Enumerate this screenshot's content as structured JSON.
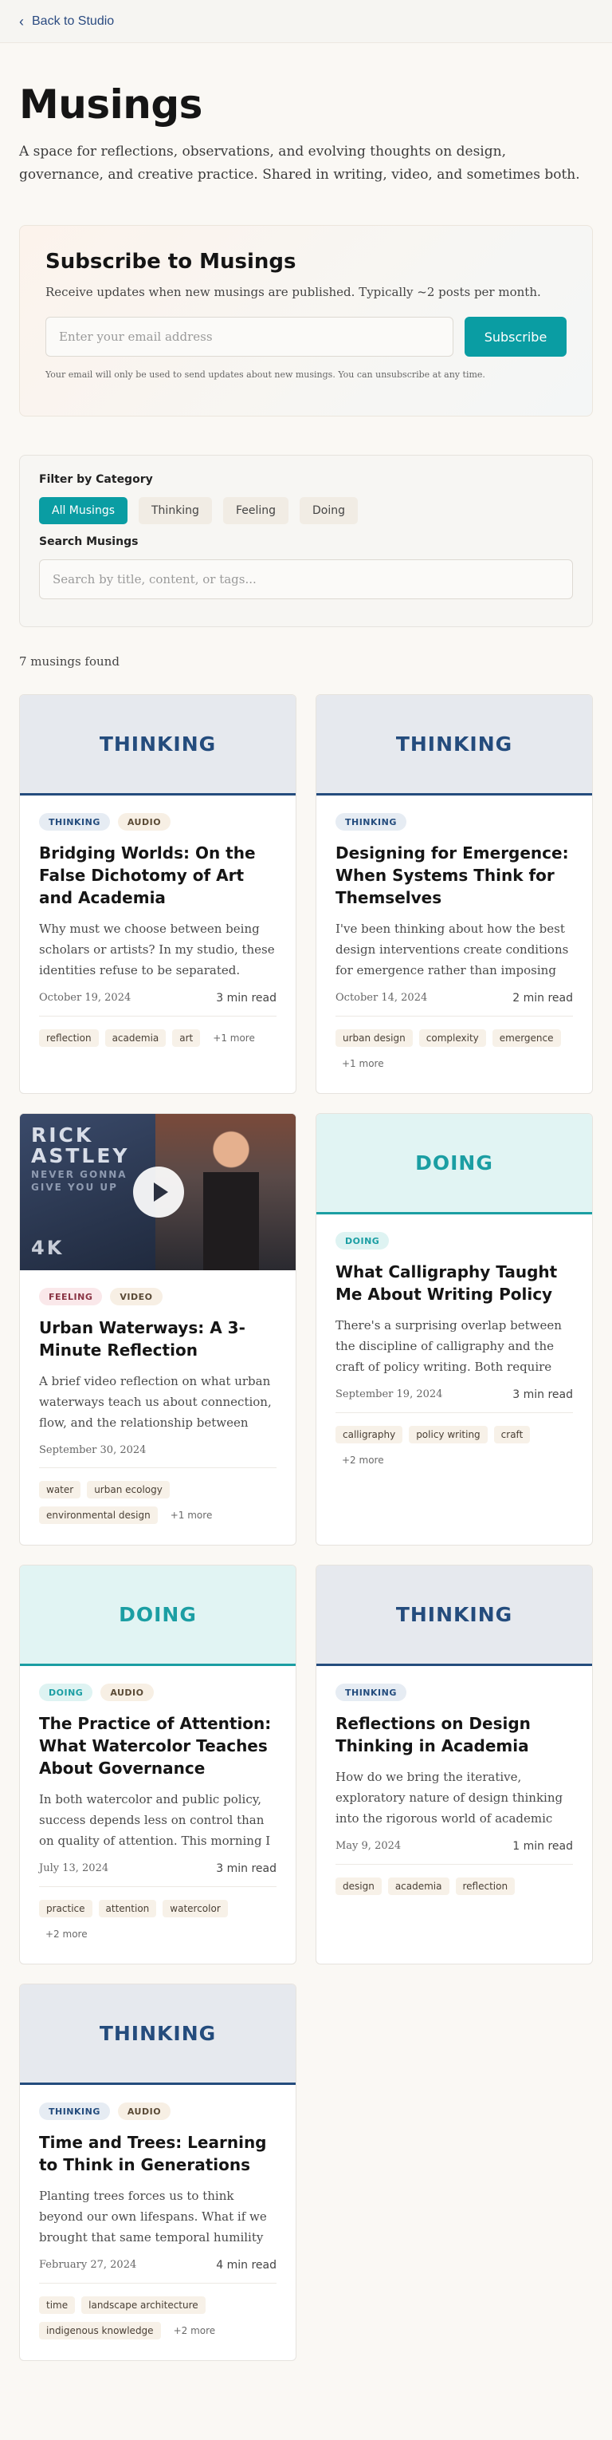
{
  "nav": {
    "back_label": "Back to Studio"
  },
  "header": {
    "title": "Musings",
    "intro": "A space for reflections, observations, and evolving thoughts on design, governance, and creative practice. Shared in writing, video, and sometimes both."
  },
  "subscribe": {
    "title": "Subscribe to Musings",
    "description": "Receive updates when new musings are published. Typically ~2 posts per month.",
    "email_placeholder": "Enter your email address",
    "button_label": "Subscribe",
    "fineprint": "Your email will only be used to send updates about new musings. You can unsubscribe at any time."
  },
  "filters": {
    "category_label": "Filter by Category",
    "categories": [
      "All Musings",
      "Thinking",
      "Feeling",
      "Doing"
    ],
    "active_category": "All Musings",
    "search_label": "Search Musings",
    "search_placeholder": "Search by title, content, or tags..."
  },
  "results": {
    "count_text": "7 musings found"
  },
  "colors": {
    "accent": "#0a9da3",
    "thinking": "#244c7d",
    "doing": "#1b9ea3",
    "feeling": "#8a3444"
  },
  "video_thumbnail": {
    "title_line1": "RICK",
    "title_line2": "ASTLEY",
    "sub_line1": "NEVER GONNA",
    "sub_line2": "GIVE YOU UP",
    "quality": "4K"
  },
  "cards": [
    {
      "header_label": "THINKING",
      "category": "thinking",
      "badges": [
        "THINKING",
        "AUDIO"
      ],
      "title": "Bridging Worlds: On the False Dichotomy of Art and Academia",
      "excerpt": "Why must we choose between being scholars or artists? In my studio, these identities refuse to be separated.",
      "date": "October 19, 2024",
      "read": "3 min read",
      "tags": [
        "reflection",
        "academia",
        "art"
      ],
      "more": "+1 more"
    },
    {
      "header_label": "THINKING",
      "category": "thinking",
      "badges": [
        "THINKING"
      ],
      "title": "Designing for Emergence: When Systems Think for Themselves",
      "excerpt": "I've been thinking about how the best design interventions create conditions for emergence rather than imposing solutions.",
      "date": "October 14, 2024",
      "read": "2 min read",
      "tags": [
        "urban design",
        "complexity",
        "emergence"
      ],
      "more": "+1 more"
    },
    {
      "header_label": "",
      "category": "feeling",
      "video": true,
      "badges": [
        "FEELING",
        "VIDEO"
      ],
      "title": "Urban Waterways: A 3-Minute Reflection",
      "excerpt": "A brief video reflection on what urban waterways teach us about connection, flow, and the relationship between nature and city.",
      "date": "September 30, 2024",
      "read": "",
      "tags": [
        "water",
        "urban ecology",
        "environmental design"
      ],
      "more": "+1 more"
    },
    {
      "header_label": "DOING",
      "category": "doing",
      "badges": [
        "DOING"
      ],
      "title": "What Calligraphy Taught Me About Writing Policy",
      "excerpt": "There's a surprising overlap between the discipline of calligraphy and the craft of policy writing. Both require patience.",
      "date": "September 19, 2024",
      "read": "3 min read",
      "tags": [
        "calligraphy",
        "policy writing",
        "craft"
      ],
      "more": "+2 more"
    },
    {
      "header_label": "DOING",
      "category": "doing",
      "badges": [
        "DOING",
        "AUDIO"
      ],
      "title": "The Practice of Attention: What Watercolor Teaches About Governance",
      "excerpt": "In both watercolor and public policy, success depends less on control than on quality of attention. This morning I noticed.",
      "date": "July 13, 2024",
      "read": "3 min read",
      "tags": [
        "practice",
        "attention",
        "watercolor"
      ],
      "more": "+2 more"
    },
    {
      "header_label": "THINKING",
      "category": "thinking",
      "badges": [
        "THINKING"
      ],
      "title": "Reflections on Design Thinking in Academia",
      "excerpt": "How do we bring the iterative, exploratory nature of design thinking into the rigorous world of academic research?",
      "date": "May 9, 2024",
      "read": "1 min read",
      "tags": [
        "design",
        "academia",
        "reflection"
      ],
      "more": ""
    },
    {
      "header_label": "THINKING",
      "category": "thinking",
      "badges": [
        "THINKING",
        "AUDIO"
      ],
      "title": "Time and Trees: Learning to Think in Generations",
      "excerpt": "Planting trees forces us to think beyond our own lifespans. What if we brought that same temporal humility to policy?",
      "date": "February 27, 2024",
      "read": "4 min read",
      "tags": [
        "time",
        "landscape architecture",
        "indigenous knowledge"
      ],
      "more": "+2 more"
    }
  ]
}
